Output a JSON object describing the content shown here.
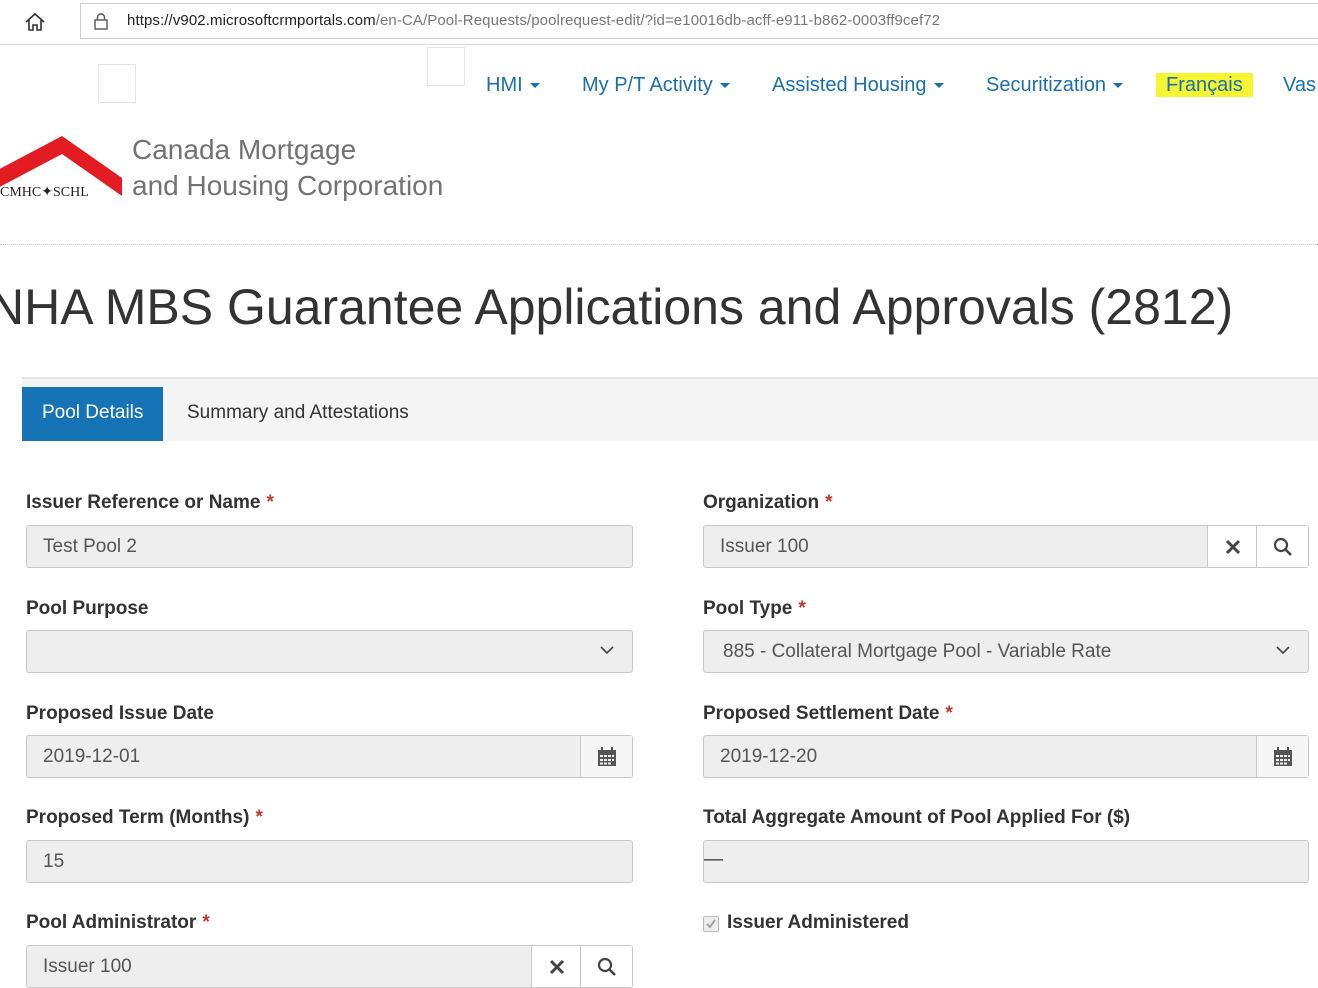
{
  "browser": {
    "url_host": "https://v902.microsoftcrmportals.com",
    "url_path": "/en-CA/Pool-Requests/poolrequest-edit/?id=e10016db-acff-e911-b862-0003ff9cef72"
  },
  "nav": {
    "items": [
      {
        "label": "HMI"
      },
      {
        "label": "My P/T Activity"
      },
      {
        "label": "Assisted Housing"
      },
      {
        "label": "Securitization"
      },
      {
        "label": "Français"
      },
      {
        "label": "Vas"
      }
    ]
  },
  "logo": {
    "wordmark": "CMHC✦SCHL",
    "line1": "Canada Mortgage",
    "line2": "and Housing Corporation"
  },
  "page": {
    "title": "NHA MBS Guarantee Applications and Approvals (2812)"
  },
  "tabs": [
    {
      "label": "Pool Details"
    },
    {
      "label": "Summary and Attestations"
    }
  ],
  "form": {
    "required_mark": "*",
    "issuer_ref": {
      "label": "Issuer Reference or Name",
      "value": "Test Pool 2"
    },
    "organization": {
      "label": "Organization",
      "value": "Issuer 100"
    },
    "pool_purpose": {
      "label": "Pool Purpose",
      "value": ""
    },
    "pool_type": {
      "label": "Pool Type",
      "value": "885 - Collateral Mortgage Pool - Variable Rate"
    },
    "issue_date": {
      "label": "Proposed Issue Date",
      "value": "2019-12-01"
    },
    "settlement_date": {
      "label": "Proposed Settlement Date",
      "value": "2019-12-20"
    },
    "term": {
      "label": "Proposed Term (Months)",
      "value": "15"
    },
    "aggregate": {
      "label": "Total Aggregate Amount of Pool Applied For ($)",
      "value": "—"
    },
    "administrator": {
      "label": "Pool Administrator",
      "value": "Issuer 100"
    },
    "issuer_administered": {
      "label": "Issuer Administered",
      "checked": true
    }
  },
  "colors": {
    "brand_blue": "#1673b6",
    "link_blue": "#1a6fb0",
    "logo_red": "#e31b23",
    "highlight": "#f5f532"
  }
}
